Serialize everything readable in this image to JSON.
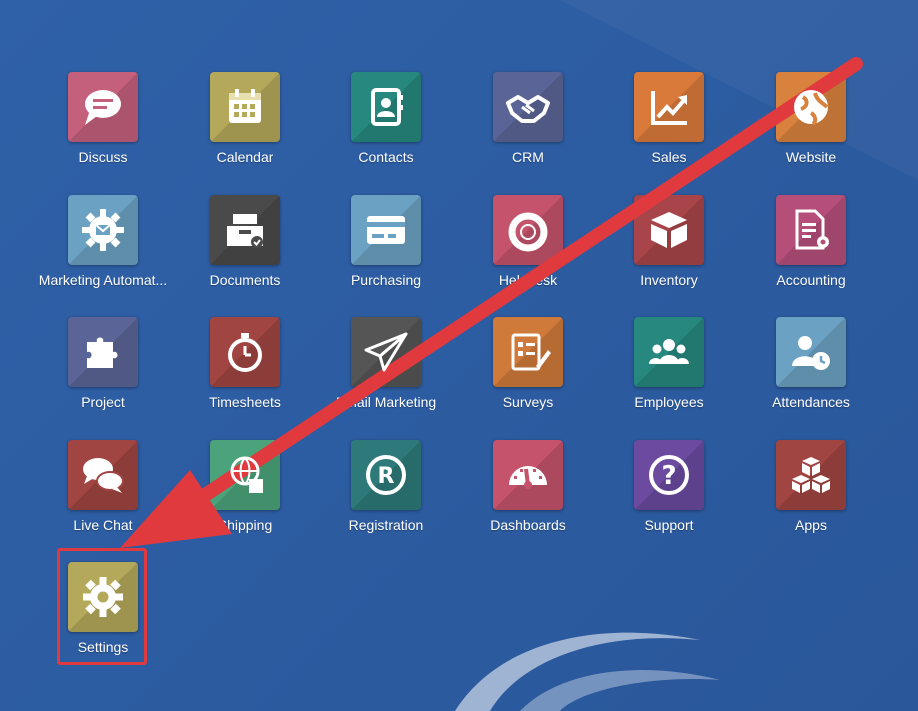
{
  "apps": [
    {
      "label": "Discuss",
      "icon": "chat-bubble-icon",
      "color": "#c4607c"
    },
    {
      "label": "Calendar",
      "icon": "calendar-icon",
      "color": "#b4a85a"
    },
    {
      "label": "Contacts",
      "icon": "address-book-icon",
      "color": "#26887e"
    },
    {
      "label": "CRM",
      "icon": "handshake-icon",
      "color": "#5b6496"
    },
    {
      "label": "Sales",
      "icon": "chart-line-icon",
      "color": "#d97a3a"
    },
    {
      "label": "Website",
      "icon": "globe-icon",
      "color": "#d8823e"
    },
    {
      "label": "Marketing Automat...",
      "icon": "gear-mail-icon",
      "color": "#6ba1c2"
    },
    {
      "label": "Documents",
      "icon": "inbox-tray-icon",
      "color": "#4a4a4a"
    },
    {
      "label": "Purchasing",
      "icon": "credit-card-icon",
      "color": "#6ba1c2"
    },
    {
      "label": "Helpdesk",
      "icon": "life-ring-icon",
      "color": "#c5536c"
    },
    {
      "label": "Inventory",
      "icon": "box-icon",
      "color": "#a8454a"
    },
    {
      "label": "Accounting",
      "icon": "document-gear-icon",
      "color": "#b64e7a"
    },
    {
      "label": "Project",
      "icon": "puzzle-icon",
      "color": "#5b6496"
    },
    {
      "label": "Timesheets",
      "icon": "stopwatch-icon",
      "color": "#a04541"
    },
    {
      "label": "Email Marketing",
      "icon": "paper-plane-icon",
      "color": "#555555"
    },
    {
      "label": "Surveys",
      "icon": "checklist-icon",
      "color": "#cf7a3a"
    },
    {
      "label": "Employees",
      "icon": "users-icon",
      "color": "#26887e"
    },
    {
      "label": "Attendances",
      "icon": "user-clock-icon",
      "color": "#6ba1c2"
    },
    {
      "label": "Live Chat",
      "icon": "chat-bubbles-icon",
      "color": "#a04541"
    },
    {
      "label": "Shipping",
      "icon": "globe-box-icon",
      "color": "#4aa37a"
    },
    {
      "label": "Registration",
      "icon": "registered-icon",
      "color": "#2e7a7a"
    },
    {
      "label": "Dashboards",
      "icon": "gauge-icon",
      "color": "#c5536c"
    },
    {
      "label": "Support",
      "icon": "question-icon",
      "color": "#6b4aa0"
    },
    {
      "label": "Apps",
      "icon": "cubes-icon",
      "color": "#a04541"
    },
    {
      "label": "Settings",
      "icon": "gear-icon",
      "color": "#b4a85a"
    }
  ],
  "annotation": {
    "highlight_target": "Settings",
    "arrow_color": "#e0393e"
  }
}
